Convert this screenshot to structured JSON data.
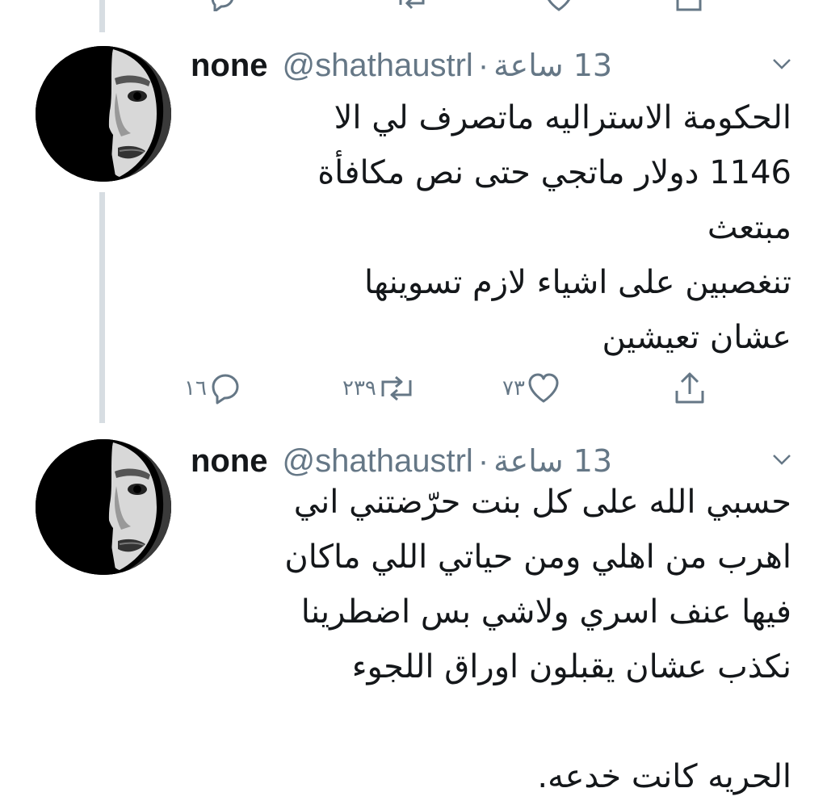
{
  "tweets": [
    {
      "display_name": "none",
      "handle": "@shathaustrl",
      "separator": "·",
      "timestamp": "13 ساعة",
      "body_lines": [
        "الحكومة الاستراليه ماتصرف لي الا",
        "1146 دولار ماتجي حتى نص مكافأة",
        "مبتعث",
        "تنغصبين على اشياء لازم تسوينها",
        "عشان تعيشين"
      ],
      "actions": {
        "reply_count": "١٦",
        "retweet_count": "٢٣٩",
        "like_count": "٧٣"
      },
      "icons": {
        "avatar": "avatar-portrait",
        "menu": "chevron-down-icon",
        "reply": "reply-icon",
        "retweet": "retweet-icon",
        "like": "heart-icon",
        "share": "share-icon"
      }
    },
    {
      "display_name": "none",
      "handle": "@shathaustrl",
      "separator": "·",
      "timestamp": "13 ساعة",
      "body_lines": [
        "حسبي الله على كل بنت حرّضتني اني",
        "اهرب من اهلي ومن حياتي اللي ماكان",
        "فيها عنف اسري ولاشي بس اضطرينا",
        "نكذب عشان يقبلون اوراق اللجوء",
        "",
        "الحريه كانت خدعه."
      ],
      "icons": {
        "avatar": "avatar-portrait",
        "menu": "chevron-down-icon"
      }
    }
  ],
  "colors": {
    "text": "#14171a",
    "secondary": "#657786",
    "thread_line": "#d7dde2",
    "background": "#ffffff"
  }
}
